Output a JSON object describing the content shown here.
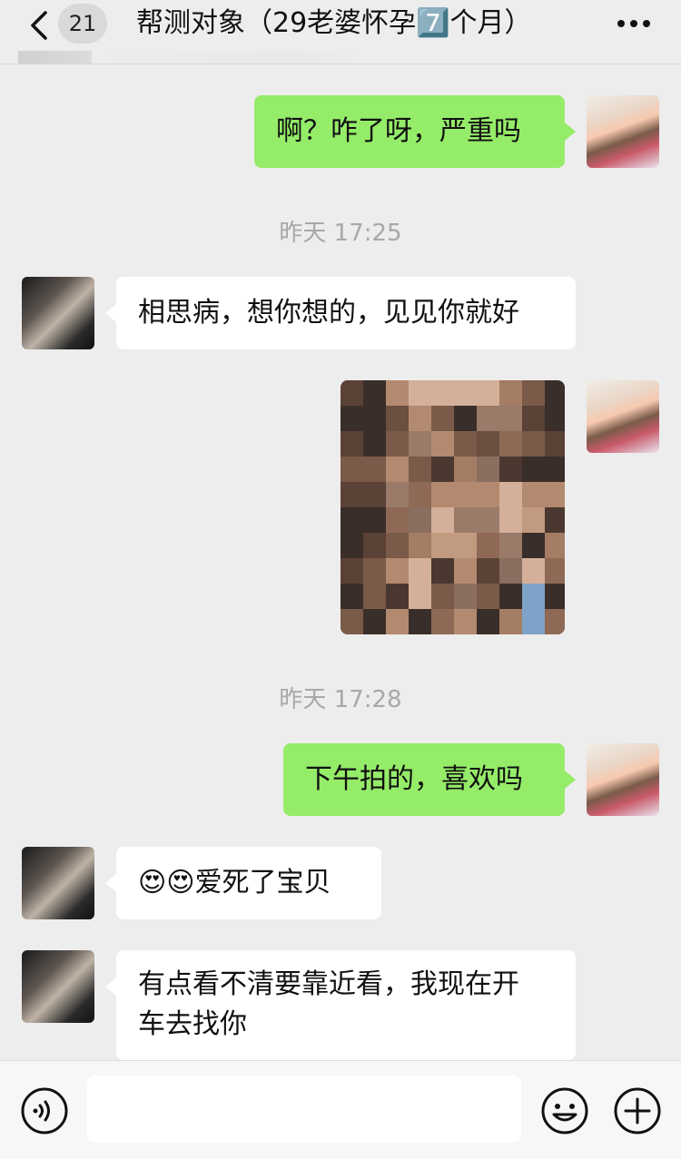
{
  "header": {
    "unread_count": "21",
    "title": "帮测对象（29老婆怀孕7️⃣个月）"
  },
  "messages": [
    {
      "side": "out",
      "text": "啊？咋了呀，严重吗"
    },
    {
      "side": "time",
      "text": "昨天 17:25"
    },
    {
      "side": "in",
      "text": "相思病，想你想的，见见你就好"
    },
    {
      "side": "out",
      "type": "image",
      "description_label": "photo"
    },
    {
      "side": "time",
      "text": "昨天 17:28"
    },
    {
      "side": "out",
      "text": "下午拍的，喜欢吗"
    },
    {
      "side": "in",
      "emoji": "😍😍",
      "text": "爱死了宝贝"
    },
    {
      "side": "in",
      "text_line1": "有点看不清要靠近看，我现在开",
      "text_line2": "车去找你"
    }
  ],
  "input": {
    "value": "",
    "placeholder": ""
  },
  "icons": {
    "back": "chevron-left-icon",
    "more": "more-dots-icon",
    "voice": "voice-icon",
    "emoji": "smiley-icon",
    "plus": "plus-icon"
  },
  "colors": {
    "background": "#ededed",
    "outgoing_bubble": "#95ec69",
    "incoming_bubble": "#ffffff",
    "timestamp": "#a8a8a8"
  }
}
